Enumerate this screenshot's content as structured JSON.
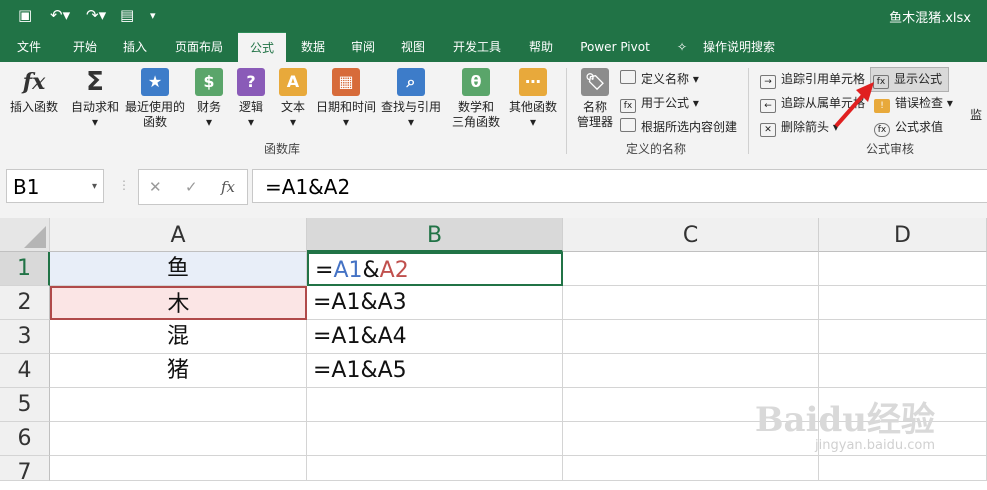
{
  "title_bar": {
    "file_title": "鱼木混猪.xlsx"
  },
  "tabs": [
    "文件",
    "开始",
    "插入",
    "页面布局",
    "公式",
    "数据",
    "审阅",
    "视图",
    "开发工具",
    "帮助",
    "Power Pivot",
    "操作说明搜索"
  ],
  "active_tab": "公式",
  "ribbon": {
    "library": {
      "insert_function": "插入函数",
      "autosum": "自动求和",
      "recent_l1": "最近使用的",
      "recent_l2": "函数",
      "financial": "财务",
      "logical": "逻辑",
      "text": "文本",
      "datetime": "日期和时间",
      "lookup": "查找与引用",
      "math_l1": "数学和",
      "math_l2": "三角函数",
      "more": "其他函数",
      "group_label": "函数库"
    },
    "names": {
      "manager_l1": "名称",
      "manager_l2": "管理器",
      "define_name": "定义名称",
      "use_in_formula": "用于公式",
      "create_from_selection": "根据所选内容创建",
      "group_label": "定义的名称"
    },
    "audit": {
      "trace_precedents": "追踪引用单元格",
      "trace_dependents": "追踪从属单元格",
      "remove_arrows": "删除箭头",
      "show_formulas": "显示公式",
      "error_checking": "错误检查",
      "evaluate_formula": "公式求值",
      "group_label": "公式审核",
      "watch_partial": "监"
    }
  },
  "formula_bar": {
    "name_box": "B1",
    "formula": "=A1&A2"
  },
  "grid": {
    "columns": [
      "A",
      "B",
      "C",
      "D"
    ],
    "rows": [
      {
        "num": "1",
        "a": "鱼",
        "b": "=A1&A2"
      },
      {
        "num": "2",
        "a": "木",
        "b": "=A1&A3"
      },
      {
        "num": "3",
        "a": "混",
        "b": "=A1&A4"
      },
      {
        "num": "4",
        "a": "猪",
        "b": "=A1&A5"
      },
      {
        "num": "5",
        "a": "",
        "b": ""
      },
      {
        "num": "6",
        "a": "",
        "b": ""
      },
      {
        "num": "7",
        "a": "",
        "b": ""
      }
    ],
    "b1_parts": [
      "=",
      "A1",
      "&",
      "A2"
    ]
  },
  "colors": {
    "excel_green": "#217346",
    "ref_blue": "#4472c4",
    "ref_red": "#c0504d"
  },
  "watermark": {
    "brand": "Baidu经验",
    "url": "jingyan.baidu.com"
  }
}
